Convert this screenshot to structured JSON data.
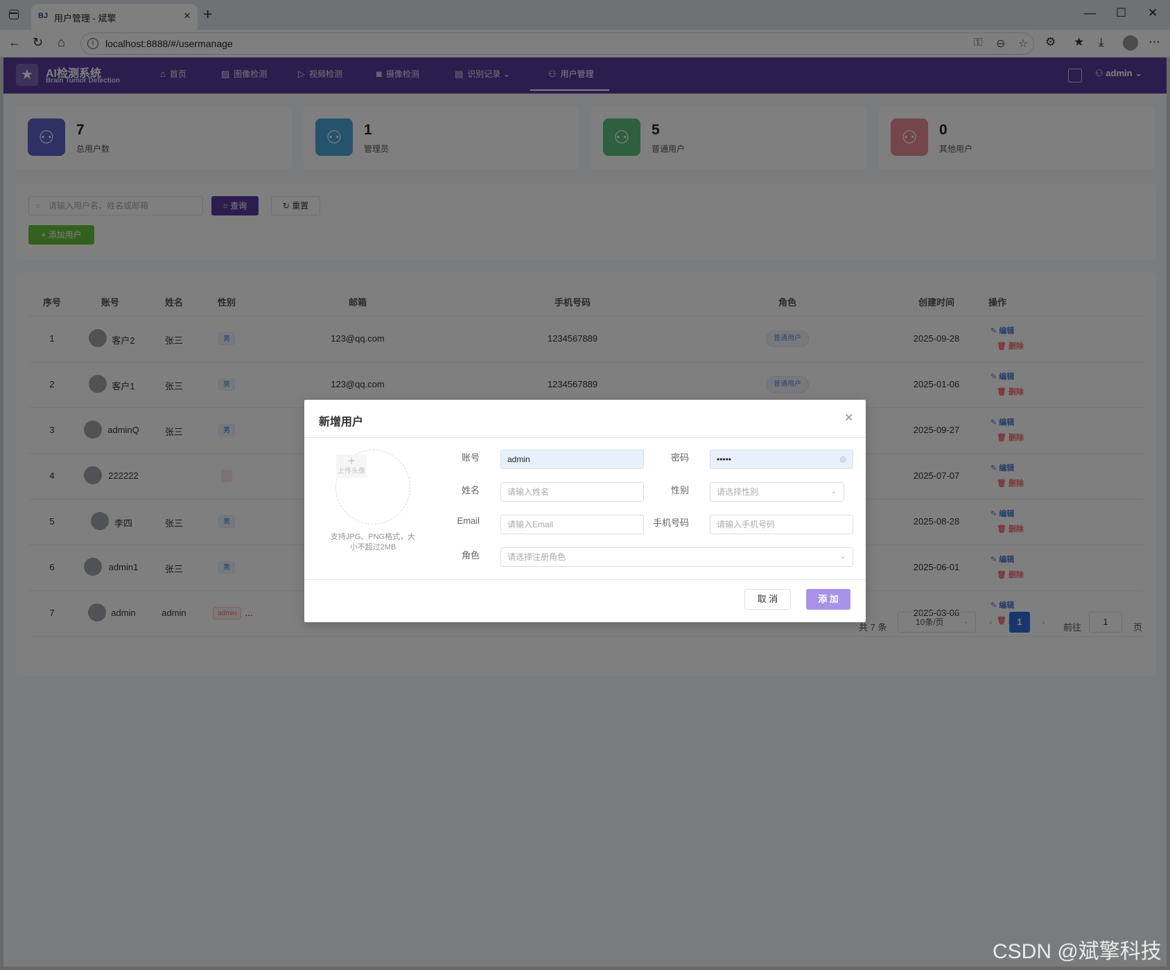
{
  "browser": {
    "tab_favicon": "BJ",
    "tab_title": "用户管理 - 斌擎",
    "url": "localhost:8888/#/usermanage"
  },
  "app": {
    "logo_title": "AI检测系统",
    "logo_sub": "Brain Tumor Detection",
    "menu": [
      {
        "label": "首页",
        "icon": "home-icon"
      },
      {
        "label": "图像检测",
        "icon": "image-icon"
      },
      {
        "label": "视频检测",
        "icon": "video-icon"
      },
      {
        "label": "摄像检测",
        "icon": "camera-icon"
      },
      {
        "label": "识别记录",
        "icon": "document-icon"
      },
      {
        "label": "用户管理",
        "icon": "user-icon"
      }
    ],
    "user": "admin"
  },
  "stats": [
    {
      "value": "7",
      "label": "总用户数",
      "color": "#5a63c8"
    },
    {
      "value": "1",
      "label": "管理员",
      "color": "#4aa6db"
    },
    {
      "value": "5",
      "label": "普通用户",
      "color": "#5cc17e"
    },
    {
      "value": "0",
      "label": "其他用户",
      "color": "#ea8a98"
    }
  ],
  "search": {
    "placeholder": "请输入用户名、姓名或邮箱",
    "query_label": "查询",
    "reset_label": "重置",
    "add_label": "添加用户"
  },
  "table": {
    "headers": [
      "序号",
      "账号",
      "姓名",
      "性别",
      "邮箱",
      "手机号码",
      "角色",
      "创建时间",
      "操作"
    ],
    "rows": [
      {
        "index": "1",
        "account": "客户2",
        "name": "张三",
        "gender": "男",
        "email": "123@qq.com",
        "phone": "1234567889",
        "role": "普通用户",
        "created": "2025-09-28"
      },
      {
        "index": "2",
        "account": "客户1",
        "name": "张三",
        "gender": "男",
        "email": "123@qq.com",
        "phone": "1234567889",
        "role": "普通用户",
        "created": "2025-01-06"
      },
      {
        "index": "3",
        "account": "adminQ",
        "name": "张三",
        "gender": "男",
        "created": "2025-09-27"
      },
      {
        "index": "4",
        "account": "222222",
        "name": "",
        "gender": "",
        "created": "2025-07-07"
      },
      {
        "index": "5",
        "account": "李四",
        "name": "张三",
        "gender": "男",
        "created": "2025-08-28"
      },
      {
        "index": "6",
        "account": "admin1",
        "name": "张三",
        "gender": "男",
        "created": "2025-06-01"
      },
      {
        "index": "7",
        "account": "admin",
        "name": "admin",
        "gender": "admin",
        "created": "2025-03-06"
      }
    ],
    "edit_label": "编辑",
    "delete_label": "删除",
    "ellipsis": "..."
  },
  "pagination": {
    "total": "共 7 条",
    "page_size": "10条/页",
    "current": "1",
    "goto_label": "前往",
    "goto_value": "1",
    "page_suffix": "页"
  },
  "modal": {
    "title": "新增用户",
    "upload_text": "上传头像",
    "upload_tip": "支持JPG、PNG格式，大小不超过2MB",
    "account_label": "账号",
    "account_value": "admin",
    "password_label": "密码",
    "password_value": "•••••",
    "name_label": "姓名",
    "name_placeholder": "请输入姓名",
    "gender_label": "性别",
    "gender_placeholder": "请选择性别",
    "email_label": "Email",
    "email_placeholder": "请输入Email",
    "phone_label": "手机号码",
    "phone_placeholder": "请输入手机号码",
    "role_label": "角色",
    "role_placeholder": "请选择注册角色",
    "cancel_label": "取 消",
    "submit_label": "添 加"
  },
  "watermark": "CSDN @斌擎科技"
}
